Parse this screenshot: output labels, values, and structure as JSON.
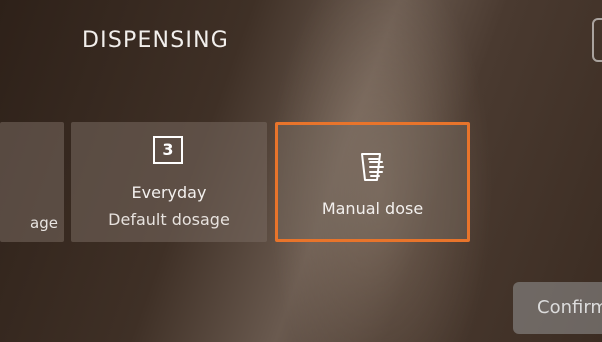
{
  "screen": {
    "title": "DISPENSING"
  },
  "modes": [
    {
      "name": "left-partial",
      "label": "age"
    },
    {
      "name": "everyday",
      "badge": "3",
      "title": "Everyday",
      "subtitle": "Default dosage"
    },
    {
      "name": "manual",
      "icon": "measuring-cup-hand-icon",
      "label": "Manual dose",
      "selected": true
    }
  ],
  "actions": {
    "confirm_label": "Confirm"
  },
  "colors": {
    "accent": "#e8742b",
    "card": "#786a60"
  }
}
